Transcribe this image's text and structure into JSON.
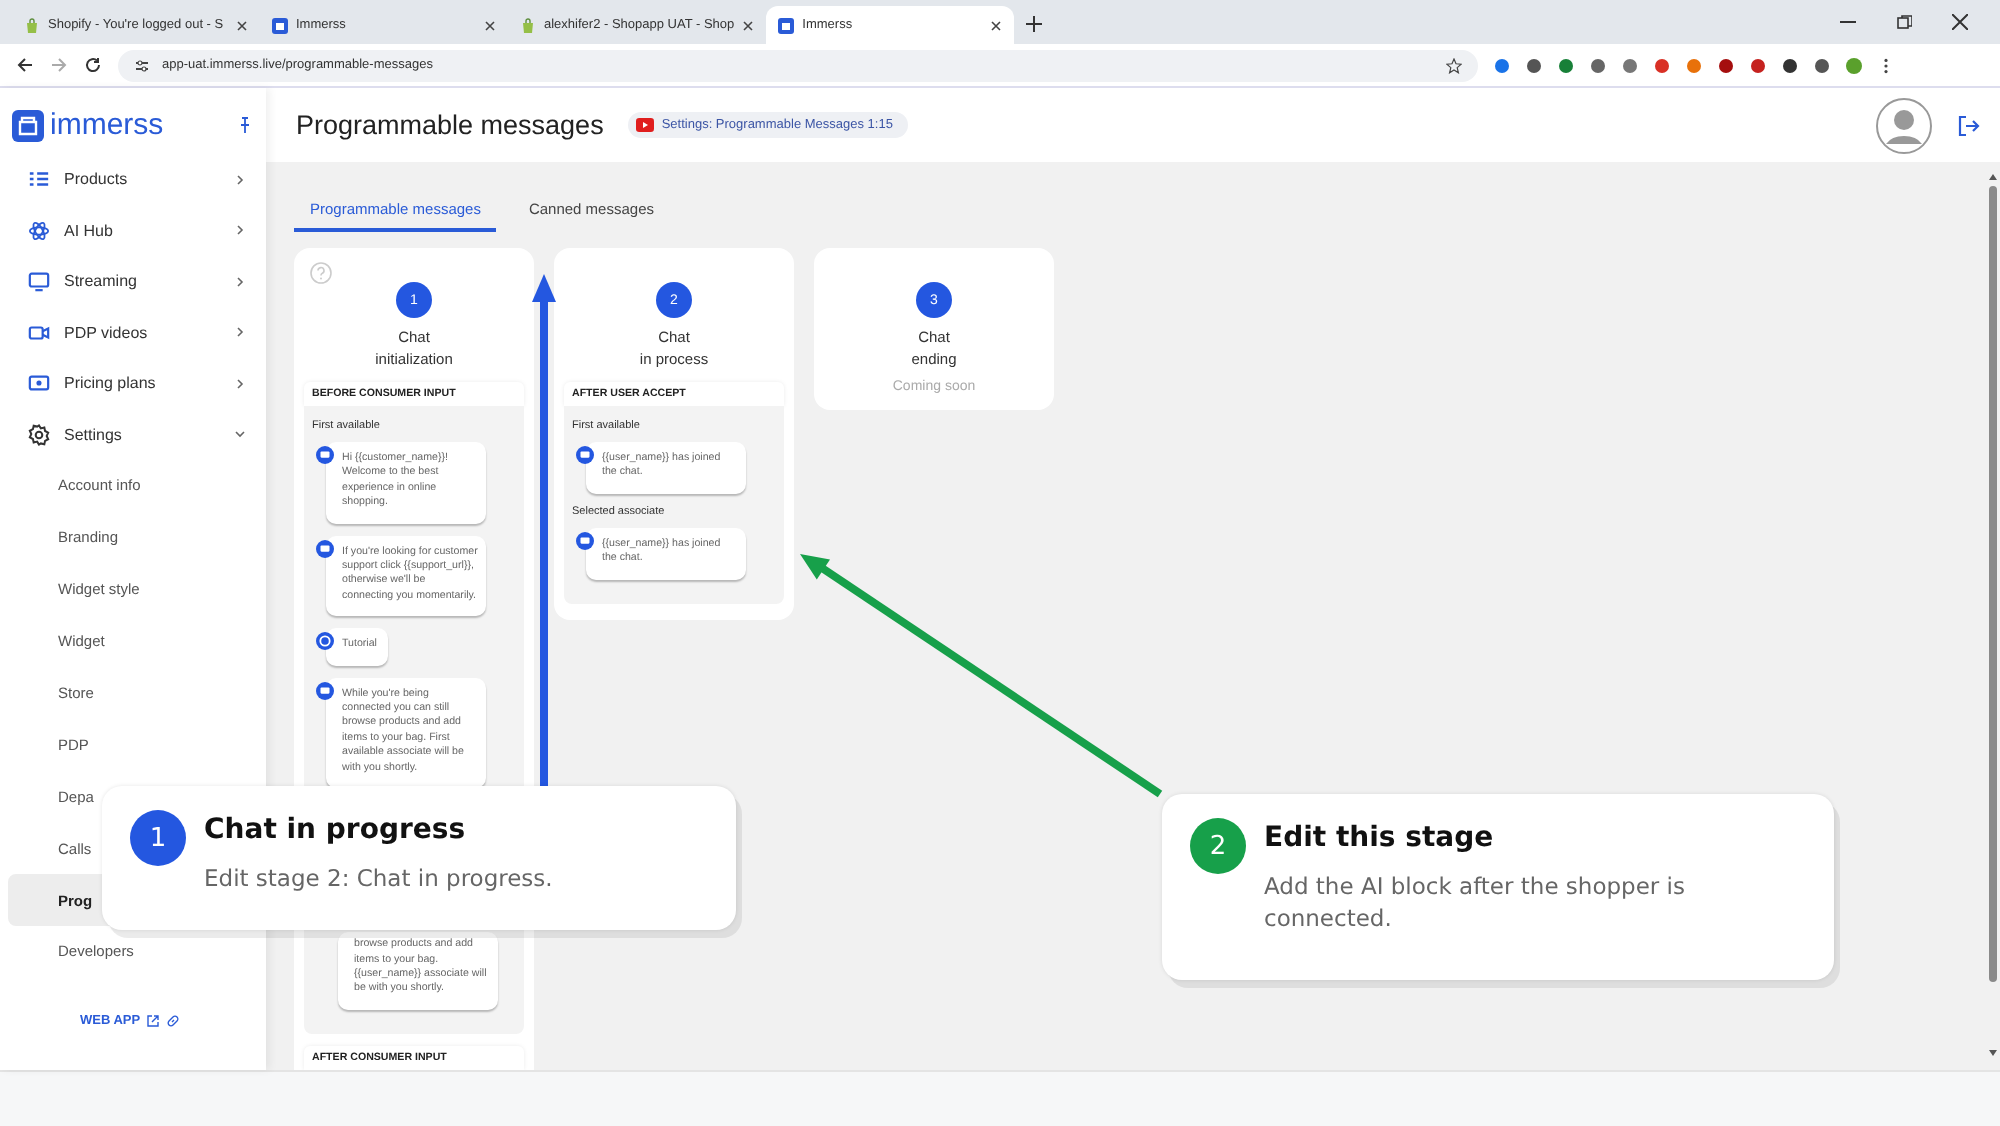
{
  "browser": {
    "tabs": [
      {
        "title": "Shopify - You're logged out - S",
        "kind": "shop",
        "selected": false
      },
      {
        "title": "Immerss",
        "kind": "app",
        "selected": false
      },
      {
        "title": "alexhifer2 - Shopapp UAT - Shop",
        "kind": "shop",
        "selected": false
      },
      {
        "title": "Immerss",
        "kind": "app",
        "selected": true
      }
    ],
    "address": "app-uat.immerss.live/programmable-messages"
  },
  "sidebar": {
    "brand": "immerss",
    "items": [
      {
        "label": "Products",
        "expanded": false
      },
      {
        "label": "AI Hub",
        "expanded": false
      },
      {
        "label": "Streaming",
        "expanded": false
      },
      {
        "label": "PDP videos",
        "expanded": false
      },
      {
        "label": "Pricing plans",
        "expanded": false
      },
      {
        "label": "Settings",
        "expanded": true,
        "children": [
          {
            "label": "Account info",
            "selected": false
          },
          {
            "label": "Branding",
            "selected": false
          },
          {
            "label": "Widget style",
            "selected": false
          },
          {
            "label": "Widget",
            "selected": false
          },
          {
            "label": "Store",
            "selected": false
          },
          {
            "label": "PDP",
            "selected": false
          },
          {
            "label": "Depa",
            "selected": false
          },
          {
            "label": "Calls",
            "selected": false
          },
          {
            "label": "Prog",
            "selected": true
          },
          {
            "label": "Developers",
            "selected": false
          }
        ]
      }
    ],
    "web_app": "WEB APP"
  },
  "header": {
    "title": "Programmable messages",
    "badge": "Settings: Programmable Messages 1:15"
  },
  "tabs": [
    {
      "label": "Programmable messages",
      "selected": true
    },
    {
      "label": "Canned messages",
      "selected": false
    }
  ],
  "stages": [
    {
      "number": "1",
      "title": "Chat\ninitialization",
      "sections": [
        {
          "heading": "BEFORE CONSUMER INPUT",
          "groups": [
            {
              "label": "First available",
              "messages": [
                {
                  "kind": "text",
                  "text": "Hi {{customer_name}}! Welcome to the best experience in online shopping."
                },
                {
                  "kind": "text",
                  "text": "If you're looking for customer support click {{support_url}}, otherwise we'll be connecting you momentarily."
                },
                {
                  "kind": "tutorial",
                  "text": "Tutorial"
                },
                {
                  "kind": "text",
                  "text": "While you're being connected you can still browse products and add items to your bag. First available associate will be with you shortly."
                },
                {
                  "kind": "continued",
                  "text": "browse products and add items to your bag. {{user_name}} associate will be with you shortly."
                }
              ]
            }
          ]
        },
        {
          "heading": "AFTER CONSUMER INPUT"
        }
      ]
    },
    {
      "number": "2",
      "title": "Chat\nin process",
      "sections": [
        {
          "heading": "AFTER USER ACCEPT",
          "groups": [
            {
              "label": "First available",
              "messages": [
                {
                  "kind": "text",
                  "text": "{{user_name}} has joined the chat."
                }
              ]
            },
            {
              "label": "Selected associate",
              "messages": [
                {
                  "kind": "text",
                  "text": "{{user_name}} has joined the chat."
                }
              ]
            }
          ]
        }
      ]
    },
    {
      "number": "3",
      "title": "Chat\nending",
      "status": "Coming soon"
    }
  ],
  "callouts": [
    {
      "number": "1",
      "title": "Chat in progress",
      "text": "Edit stage 2: Chat in progress.",
      "color": "#2457e0"
    },
    {
      "number": "2",
      "title": "Edit this stage",
      "text": "Add the AI block after the shopper is connected.",
      "color": "#17a04a"
    }
  ]
}
